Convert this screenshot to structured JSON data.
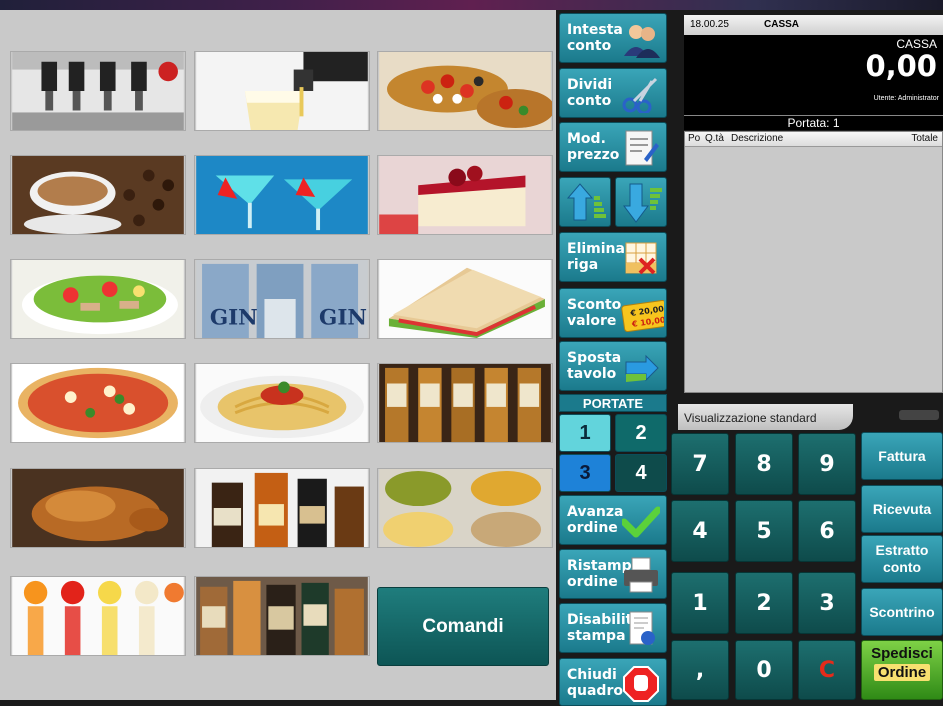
{
  "products": [
    {
      "name": "drink-dispenser"
    },
    {
      "name": "beer-tap"
    },
    {
      "name": "bruschetta"
    },
    {
      "name": "coffee"
    },
    {
      "name": "cocktail"
    },
    {
      "name": "cake"
    },
    {
      "name": "salad"
    },
    {
      "name": "gin-cans"
    },
    {
      "name": "sandwich"
    },
    {
      "name": "pizza"
    },
    {
      "name": "spaghetti"
    },
    {
      "name": "whisky-bottles"
    },
    {
      "name": "roast-chicken"
    },
    {
      "name": "liquor-bottles"
    },
    {
      "name": "snacks"
    },
    {
      "name": "juices"
    },
    {
      "name": "spirits"
    }
  ],
  "comandi_label": "Comandi",
  "functions": {
    "intesta": [
      "Intesta",
      "conto"
    ],
    "dividi": [
      "Dividi",
      "conto"
    ],
    "mod": [
      "Mod.",
      "prezzo"
    ],
    "elimina": [
      "Elimina",
      "riga"
    ],
    "sconto": [
      "Sconto",
      "valore"
    ],
    "sposta": [
      "Sposta",
      "tavolo"
    ],
    "avanza": [
      "Avanza",
      "ordine"
    ],
    "ristampa": [
      "Ristampa",
      "ordine"
    ],
    "disabilita": [
      "Disabilita",
      "stampa"
    ],
    "chiudi": [
      "Chiudi",
      "quadro"
    ]
  },
  "sconto_tag": {
    "old": "€ 20,00",
    "new": "€ 10,00"
  },
  "portate": {
    "title": "PORTATE",
    "items": [
      "1",
      "2",
      "3",
      "4"
    ]
  },
  "register": {
    "tab_time": "18.00.25",
    "tab_name": "CASSA",
    "display_label": "CASSA",
    "amount": "0,00",
    "user": "Utente: Administrator",
    "portata": "Portata: 1",
    "columns": [
      "Po",
      "Q.tà",
      "Descrizione",
      "Totale"
    ],
    "view_mode": "Visualizzazione standard"
  },
  "keypad": [
    "7",
    "8",
    "9",
    "4",
    "5",
    "6",
    "1",
    "2",
    "3",
    ",",
    "0",
    "C"
  ],
  "actions": {
    "fattura": "Fattura",
    "ricevuta": "Ricevuta",
    "estratto": [
      "Estratto",
      "conto"
    ],
    "scontrino": "Scontrino",
    "spedisci": [
      "Spedisci",
      "Ordine"
    ]
  },
  "colors": {
    "teal": "#1b7a8c",
    "dark_teal": "#0e4b4b",
    "cancel_red": "#e52b1a",
    "send_green": "#3d9a1e"
  }
}
